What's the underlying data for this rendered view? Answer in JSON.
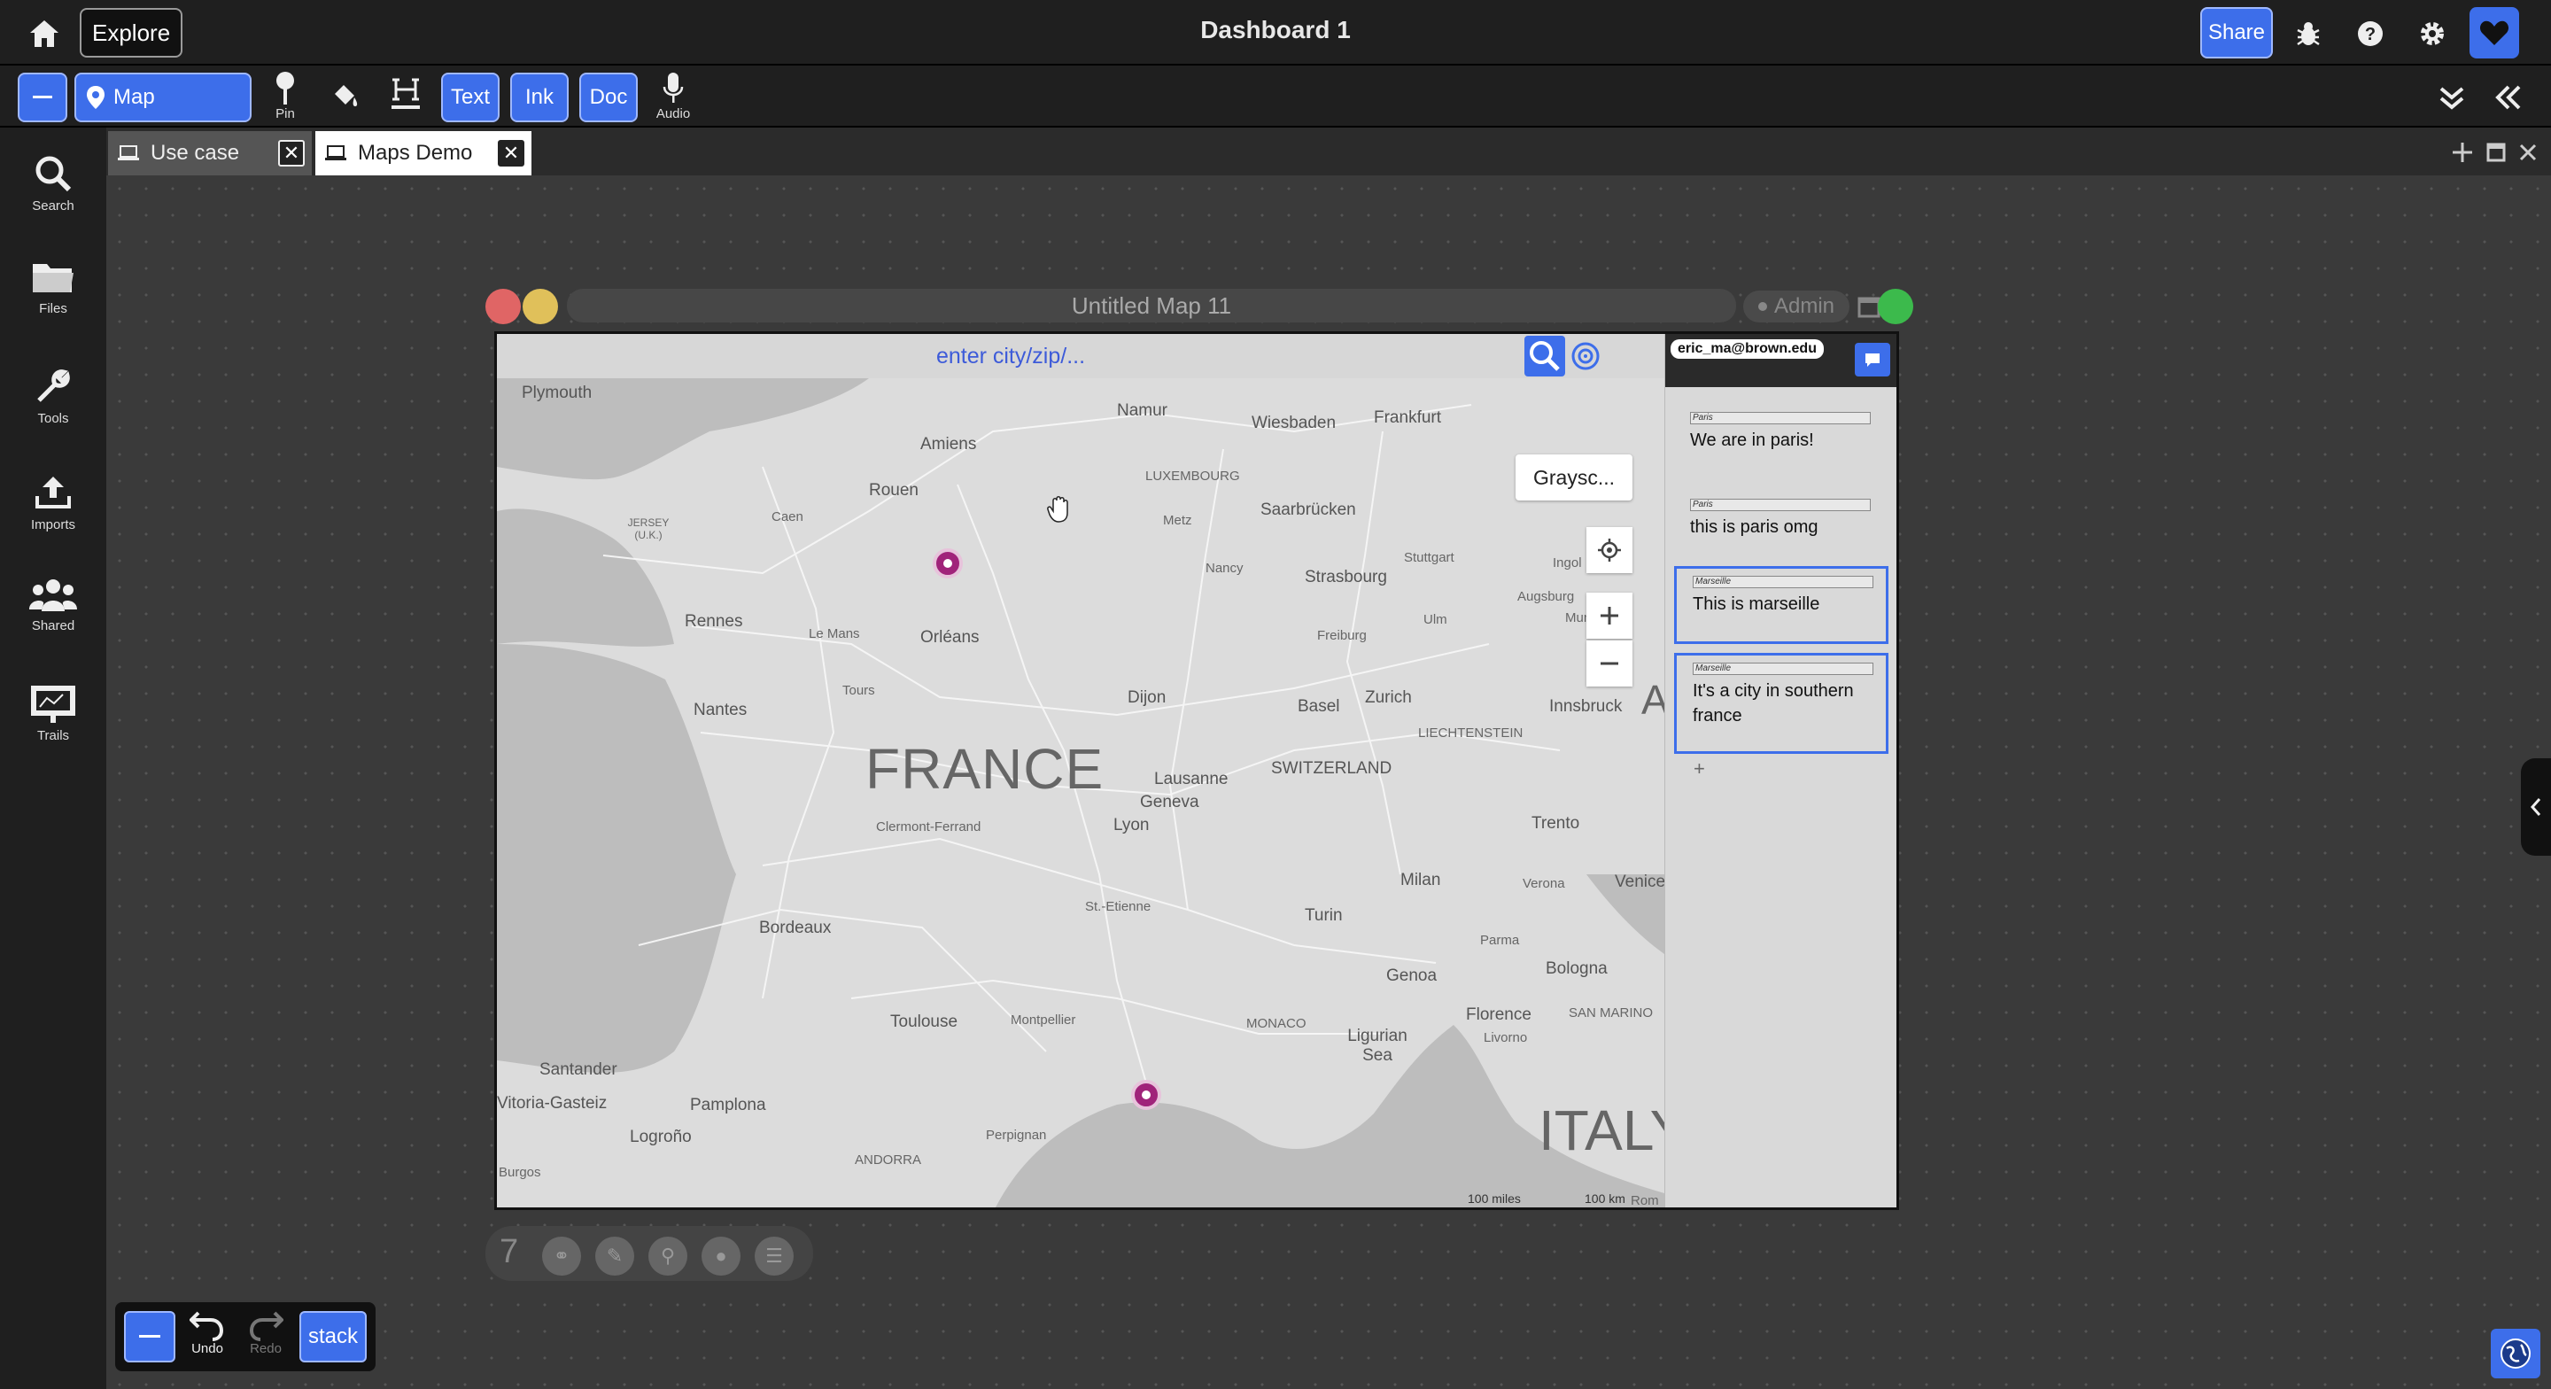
{
  "topbar": {
    "explore_label": "Explore",
    "title": "Dashboard 1",
    "share_label": "Share"
  },
  "toolbar": {
    "map_label": "Map",
    "pin_label": "Pin",
    "text_label": "Text",
    "ink_label": "Ink",
    "doc_label": "Doc",
    "audio_label": "Audio"
  },
  "tabs": [
    {
      "label": "Use case",
      "active": false
    },
    {
      "label": "Maps Demo",
      "active": true
    }
  ],
  "sidebar": {
    "items": [
      {
        "label": "Search",
        "icon": "search-icon"
      },
      {
        "label": "Files",
        "icon": "folder-icon"
      },
      {
        "label": "Tools",
        "icon": "wrench-icon"
      },
      {
        "label": "Imports",
        "icon": "upload-icon"
      },
      {
        "label": "Shared",
        "icon": "users-icon"
      },
      {
        "label": "Trails",
        "icon": "presentation-icon"
      }
    ]
  },
  "map_window": {
    "title": "Untitled Map 11",
    "admin_label": "Admin",
    "search_placeholder": "enter city/zip/...",
    "grayscale_label": "Graysc...",
    "scale_miles": "100 miles",
    "scale_km": "100 km",
    "map_labels": [
      "Plymouth",
      "Amiens",
      "Namur",
      "Wiesbaden",
      "Frankfurt",
      "LUXEMBOURG",
      "Rouen",
      "Caen",
      "Metz",
      "Saarbrücken",
      "JERSEY (U.K.)",
      "Nancy",
      "Strasbourg",
      "Stuttgart",
      "Ingol",
      "Augsburg",
      "Munich",
      "Rennes",
      "Le Mans",
      "Orléans",
      "Freiburg",
      "Ulm",
      "Nantes",
      "Tours",
      "Dijon",
      "Basel",
      "Zurich",
      "Innsbruck",
      "LIECHTENSTEIN",
      "FRANCE",
      "Lausanne",
      "SWITZERLAND",
      "Geneva",
      "Trento",
      "Clermont-Ferrand",
      "Lyon",
      "Venice",
      "Milan",
      "Verona",
      "St.-Etienne",
      "Bordeaux",
      "Turin",
      "Parma",
      "Bologna",
      "Genoa",
      "Toulouse",
      "Montpellier",
      "MONACO",
      "Ligurian Sea",
      "Florence",
      "SAN MARINO",
      "Livorno",
      "Santander",
      "Vitoria-Gasteiz",
      "Pamplona",
      "Logroño",
      "Perpignan",
      "ANDORRA",
      "Burgos",
      "ITALY",
      "A",
      "Rom"
    ]
  },
  "notes_panel": {
    "user": "eric_ma@brown.edu",
    "notes": [
      {
        "tag": "Paris",
        "text": "We are in paris!",
        "selected": false
      },
      {
        "tag": "Paris",
        "text": "this is paris omg",
        "selected": false
      },
      {
        "tag": "Marseille",
        "text": "This is marseille",
        "selected": true
      },
      {
        "tag": "Marseille",
        "text": "It's a city in southern france",
        "selected": true
      }
    ],
    "add_label": "+"
  },
  "map_footer": {
    "count": "7"
  },
  "undo_bar": {
    "undo_label": "Undo",
    "redo_label": "Redo",
    "stack_label": "stack"
  },
  "colors": {
    "accent": "#3d6eea",
    "pin": "#a0237a",
    "dark_bg": "#1f1f1f",
    "canvas": "#3a3a3a"
  }
}
